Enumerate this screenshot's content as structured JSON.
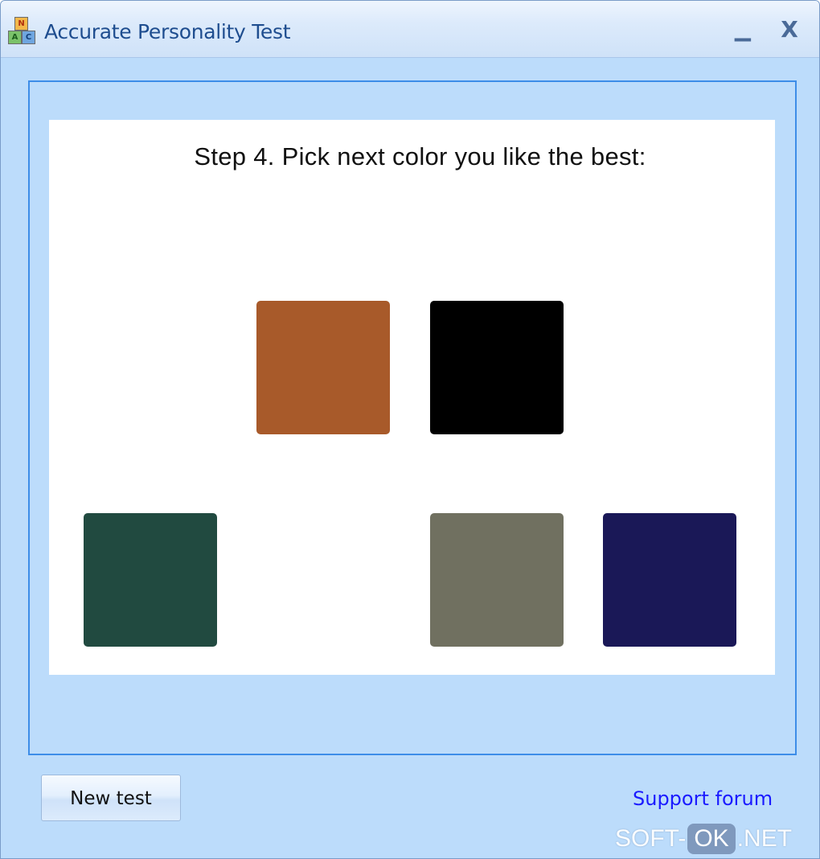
{
  "window": {
    "title": "Accurate Personality Test",
    "minimize_glyph": "▁",
    "close_glyph": "X"
  },
  "app_icon": {
    "name": "abc-blocks-icon",
    "letters": [
      "N",
      "A",
      "C"
    ]
  },
  "test": {
    "instruction": "Step 4. Pick next color you like the best:",
    "swatches": [
      {
        "color": "#a85a2a",
        "label": "brown"
      },
      {
        "color": "#000000",
        "label": "black"
      },
      {
        "color": "#214a40",
        "label": "dark green"
      },
      {
        "color": "#707060",
        "label": "gray"
      },
      {
        "color": "#1a1857",
        "label": "dark blue"
      }
    ]
  },
  "footer": {
    "new_test_label": "New test",
    "support_link_label": "Support forum"
  },
  "watermark": {
    "part1": "SOFT-",
    "part2": "OK",
    "part3": ".NET"
  },
  "colors": {
    "window_bg": "#bcdcfb",
    "frame_border": "#3d8de8",
    "link": "#1a1aff",
    "title_text": "#1e4d8f"
  }
}
